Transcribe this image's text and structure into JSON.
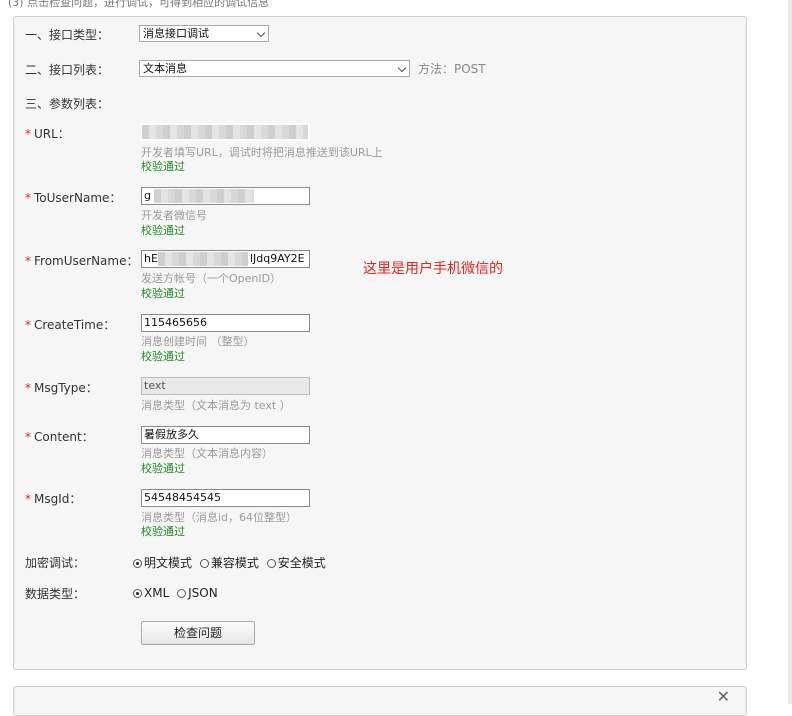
{
  "header_clip": "(3) 点击检查问题，进行调试，可得到相应的调试信息",
  "sections": {
    "interface_type_label": "一、接口类型：",
    "interface_list_label": "二、接口列表：",
    "params_label": "三、参数列表："
  },
  "interface_type": {
    "selected": "消息接口调试"
  },
  "interface_list": {
    "selected": "文本消息",
    "method": "方法：POST"
  },
  "fields": {
    "url": {
      "label": "URL：",
      "value": "",
      "hint": "开发者填写URL，调试时将把消息推送到该URL上",
      "status": "校验通过"
    },
    "to_user": {
      "label": "ToUserName：",
      "value": "g",
      "hint": "开发者微信号",
      "status": "校验通过"
    },
    "from_user": {
      "label": "FromUserName：",
      "value_prefix": "hE",
      "value_suffix": "lJdq9AY2E",
      "hint": "发送方帐号（一个OpenID）",
      "status": "校验通过"
    },
    "create_time": {
      "label": "CreateTime：",
      "value": "115465656",
      "hint": "消息创建时间 （整型）",
      "status": "校验通过"
    },
    "msg_type": {
      "label": "MsgType：",
      "value": "text",
      "hint": "消息类型（文本消息为 text ）"
    },
    "content": {
      "label": "Content：",
      "value": "暑假放多久",
      "hint": "消息类型（文本消息内容）",
      "status": "校验通过"
    },
    "msg_id": {
      "label": "MsgId：",
      "value": "54548454545",
      "hint": "消息类型（消息id，64位整型）",
      "status": "校验通过"
    }
  },
  "annotation": "这里是用户手机微信的",
  "encrypt": {
    "label": "加密调试：",
    "options": [
      "明文模式",
      "兼容模式",
      "安全模式"
    ],
    "selected": "明文模式"
  },
  "data_type": {
    "label": "数据类型：",
    "options": [
      "XML",
      "JSON"
    ],
    "selected": "XML"
  },
  "submit_label": "检查问题",
  "required_mark": "*",
  "close_symbol": "✕"
}
